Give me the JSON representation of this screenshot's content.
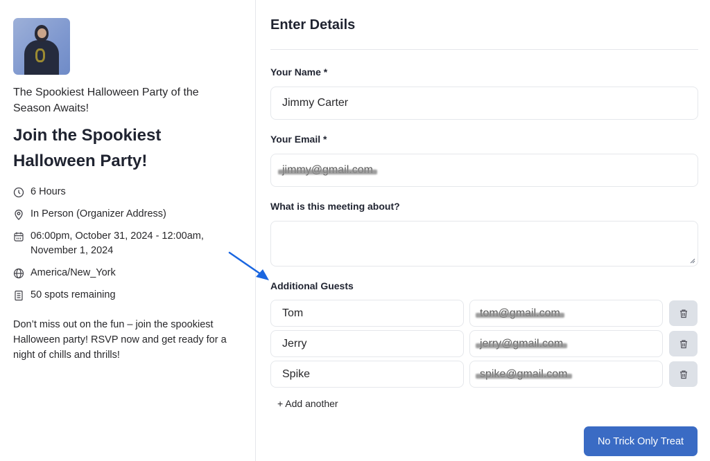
{
  "event": {
    "avatar_alt": "organizer-photo",
    "subtitle": "The Spookiest Halloween Party of the Season Awaits!",
    "title": "Join the Spookiest Halloween Party!",
    "meta": [
      {
        "icon": "clock-icon",
        "text": "6 Hours"
      },
      {
        "icon": "location-pin-icon",
        "text": "In Person (Organizer Address)"
      },
      {
        "icon": "calendar-icon",
        "text": "06:00pm, October 31, 2024 - 12:00am, November 1, 2024"
      },
      {
        "icon": "globe-icon",
        "text": "America/New_York"
      },
      {
        "icon": "document-icon",
        "text": "50 spots remaining"
      }
    ],
    "description": "Don’t miss out on the fun – join the spookiest Halloween party! RSVP now and get ready for a night of chills and thrills!"
  },
  "form": {
    "title": "Enter Details",
    "name_label": "Your Name *",
    "name_value": "Jimmy Carter",
    "email_label": "Your Email *",
    "email_value": "jimmy@gmail.com",
    "about_label": "What is this meeting about?",
    "about_value": "",
    "guests_label": "Additional Guests",
    "guests": [
      {
        "name": "Tom",
        "email": "tom@gmail.com"
      },
      {
        "name": "Jerry",
        "email": "jerry@gmail.com"
      },
      {
        "name": "Spike",
        "email": "spike@gmail.com"
      }
    ],
    "add_another_label": "+ Add another",
    "submit_label": "No Trick Only Treat"
  },
  "colors": {
    "primary_button": "#3a6bc4",
    "annotation_arrow": "#1a66e0",
    "delete_button_bg": "#dde1e7"
  }
}
